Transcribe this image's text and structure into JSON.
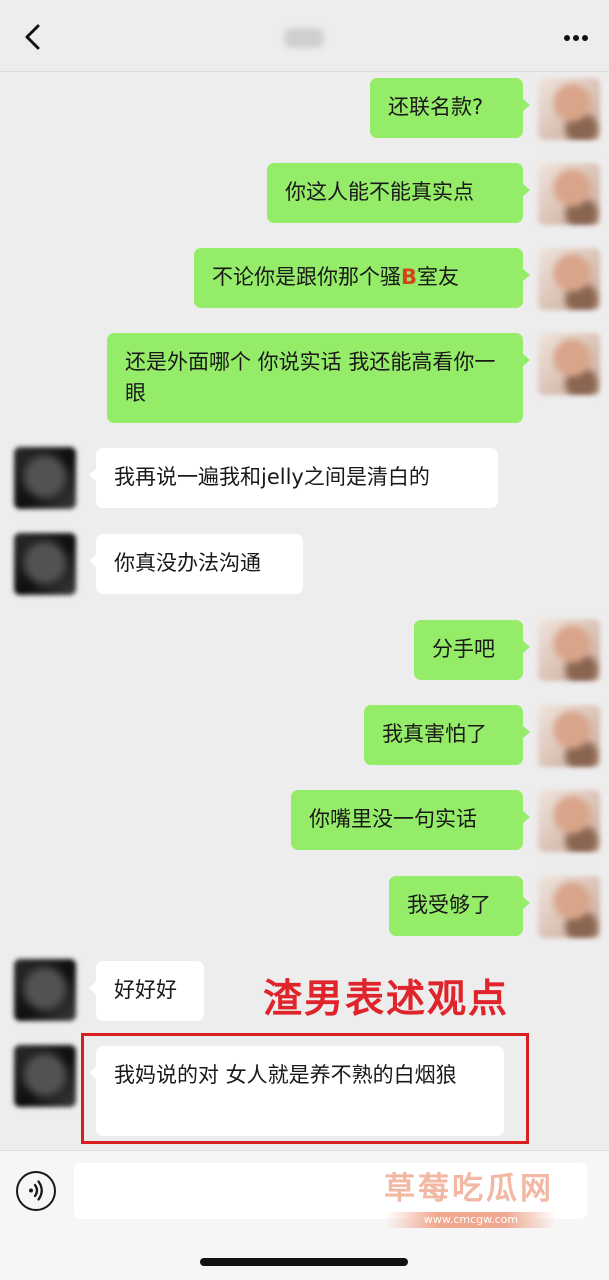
{
  "header": {
    "title": "",
    "back_icon": "chevron-left-icon",
    "more_icon": "more-dots-icon"
  },
  "messages": [
    {
      "side": "me",
      "text": "还联名款?"
    },
    {
      "side": "me",
      "text": "你这人能不能真实点"
    },
    {
      "side": "me",
      "text_before": "不论你是跟你那个骚",
      "highlight": "B",
      "text_after": "室友",
      "highlight_color": "#d2451b"
    },
    {
      "side": "me",
      "text": "还是外面哪个 你说实话 我还能高看你一眼"
    },
    {
      "side": "peer",
      "text": "我再说一遍我和jelly之间是清白的"
    },
    {
      "side": "peer",
      "text": "你真没办法沟通"
    },
    {
      "side": "me",
      "text": "分手吧"
    },
    {
      "side": "me",
      "text": "我真害怕了"
    },
    {
      "side": "me",
      "text": "你嘴里没一句实话"
    },
    {
      "side": "me",
      "text": "我受够了"
    },
    {
      "side": "peer",
      "text": "好好好"
    },
    {
      "side": "peer",
      "text": "我妈说的对 女人就是养不熟的白烟狼"
    }
  ],
  "annotation": {
    "label": "渣男表述观点",
    "color": "#e0242c"
  },
  "input_bar": {
    "voice_icon": "voice-icon",
    "watermark": "草莓吃瓜网",
    "watermark_url": "www.cmcgw.com"
  },
  "colors": {
    "my_bubble": "#95ec69",
    "peer_bubble": "#ffffff",
    "background": "#ededed"
  }
}
